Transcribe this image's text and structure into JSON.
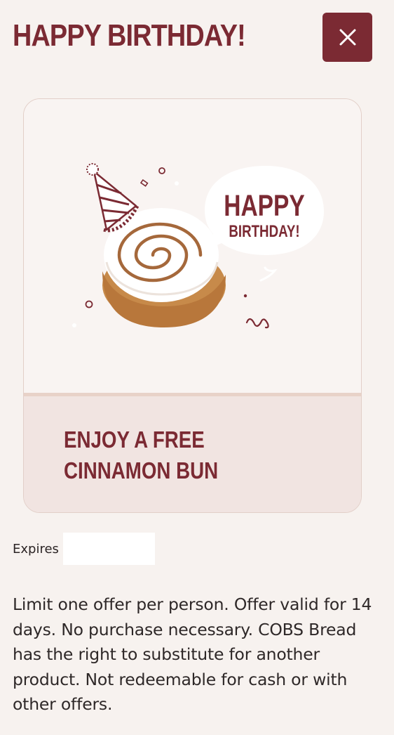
{
  "header": {
    "title": "HAPPY BIRTHDAY!",
    "close_icon": "close-icon"
  },
  "card": {
    "illustration": {
      "speech_bubble_line1": "HAPPY",
      "speech_bubble_line2": "BIRTHDAY!"
    },
    "offer_line1": "ENJOY A FREE",
    "offer_line2": "CINNAMON BUN"
  },
  "expires": {
    "label": "Expires",
    "value": ""
  },
  "terms": "Limit one offer per person. Offer valid for 14 days. No purchase necessary. COBS Bread has the right to substitute for another product. Not redeemable for cash or with other offers.",
  "colors": {
    "brand": "#7b2a33",
    "background": "#f7f2ef",
    "card_footer": "#f1e4e1"
  }
}
